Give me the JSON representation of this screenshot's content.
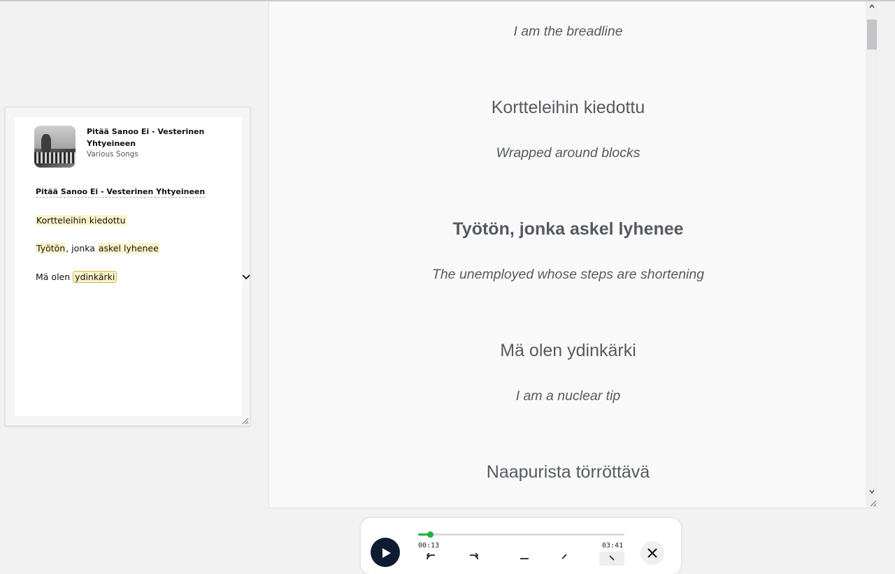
{
  "mini_player": {
    "song_title": "Pitää Sanoo Ei - Vesterinen Yhtyeineen",
    "artist": "Various Songs",
    "heading": "Pitää Sanoo Ei - Vesterinen Yhtyeineen",
    "lines": [
      {
        "parts": [
          {
            "text": "Kortteleihin kiedottu",
            "hl": "soft"
          }
        ]
      },
      {
        "parts": [
          {
            "text": "Työtön",
            "hl": "soft"
          },
          {
            "text": ", jonka ",
            "hl": "none"
          },
          {
            "text": "askel lyhenee",
            "hl": "soft"
          }
        ]
      },
      {
        "parts": [
          {
            "text": "Mä olen ",
            "hl": "none"
          },
          {
            "text": "ydinkärki",
            "hl": "box"
          }
        ]
      }
    ]
  },
  "lyrics": [
    {
      "fi": "",
      "en": "I am the breadline"
    },
    {
      "fi": "Kortteleihin kiedottu",
      "en": "Wrapped around blocks"
    },
    {
      "fi": "Työtön, jonka askel lyhenee",
      "en": "The unemployed whose steps are shortening",
      "active": true
    },
    {
      "fi": "Mä olen ydinkärki",
      "en": "I am a nuclear tip"
    },
    {
      "fi": "Naapurista törröttävä",
      "en": ""
    }
  ],
  "player": {
    "current_time": "00:13",
    "total_time": "03:41",
    "progress": 0.059,
    "accent_color": "#1db341"
  },
  "icons": {
    "play": "play-icon",
    "close": "close-icon",
    "chevron": "chevron-down-icon"
  }
}
